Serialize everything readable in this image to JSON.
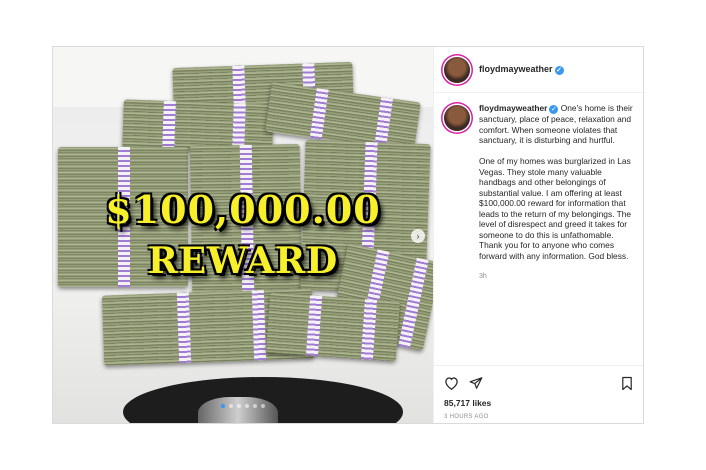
{
  "post": {
    "username": "floydmayweather",
    "verified_icon": "verified-badge-icon",
    "overlay": {
      "amount": "$100,000.00",
      "word": "REWARD"
    },
    "carousel_dots": 6,
    "caption_paragraphs": [
      "One's home is their sanctuary, place of peace, relaxation and comfort. When someone violates that sanctuary, it is disturbing and hurtful.",
      "One of my homes was burglarized in Las Vegas. They stole many valuable handbags and other belongings of substantial value. I am offering at least $100,000.00 reward for information that leads to the return of my belongings. The level of disrespect and greed it takes for someone to do this is unfathomable. Thank you for to anyone who comes forward with any information. God bless."
    ],
    "time_ago": "3h",
    "likes": "85,717 likes",
    "posted": "3 HOURS AGO",
    "accent": "#3897f0"
  }
}
